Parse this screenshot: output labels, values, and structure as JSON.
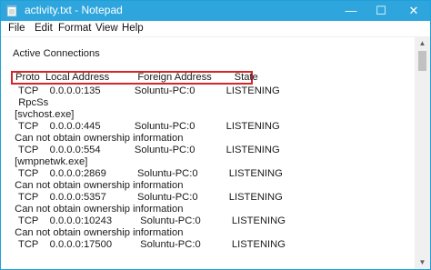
{
  "window": {
    "title": "activity.txt - Notepad",
    "minimize_glyph": "—",
    "maximize_glyph": "☐",
    "close_glyph": "✕"
  },
  "menu": {
    "items": [
      "File",
      "Edit",
      "Format",
      "View",
      "Help"
    ]
  },
  "content": {
    "lines": [
      "Active Connections",
      "Proto  Local Address          Foreign Address        State",
      "  TCP    0.0.0.0:135            Soluntu-PC:0           LISTENING",
      "  RpcSs",
      " [svchost.exe]",
      "  TCP    0.0.0.0:445            Soluntu-PC:0           LISTENING",
      " Can not obtain ownership information",
      "  TCP    0.0.0.0:554            Soluntu-PC:0           LISTENING",
      " [wmpnetwk.exe]",
      "  TCP    0.0.0.0:2869           Soluntu-PC:0           LISTENING",
      " Can not obtain ownership information",
      "  TCP    0.0.0.0:5357           Soluntu-PC:0           LISTENING",
      " Can not obtain ownership information",
      "  TCP    0.0.0.0:10243          Soluntu-PC:0           LISTENING",
      " Can not obtain ownership information",
      "  TCP    0.0.0.0:17500          Soluntu-PC:0           LISTENING"
    ]
  },
  "scrollbar": {
    "up_glyph": "▲",
    "down_glyph": "▼"
  },
  "colors": {
    "titlebar": "#2ea6dd",
    "highlight_border": "#d6252b"
  }
}
